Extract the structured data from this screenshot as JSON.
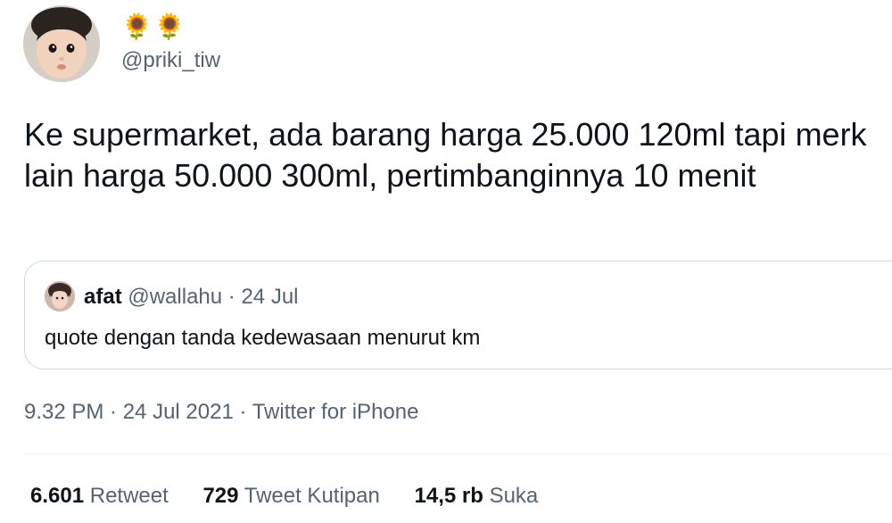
{
  "author": {
    "display_name": "🌻🌻",
    "handle": "@priki_tiw",
    "avatar_icon": "baby-face-avatar"
  },
  "tweet": {
    "text": "Ke supermarket, ada barang harga 25.000 120ml tapi merk lain harga 50.000 300ml, pertimbanginnya 10 menit"
  },
  "quoted_tweet": {
    "name": "afat",
    "handle": "@wallahu",
    "separator": "·",
    "date": "24 Jul",
    "text": "quote dengan tanda kedewasaan menurut km",
    "avatar_icon": "user-avatar"
  },
  "meta": {
    "text": "9.32 PM · 24 Jul 2021 · Twitter for iPhone"
  },
  "stats": [
    {
      "count": "6.601",
      "label": "Retweet"
    },
    {
      "count": "729",
      "label": "Tweet Kutipan"
    },
    {
      "count": "14,5 rb",
      "label": "Suka"
    }
  ],
  "colors": {
    "text_primary": "#0f1419",
    "text_secondary": "#536471",
    "border": "#cfd9de"
  }
}
